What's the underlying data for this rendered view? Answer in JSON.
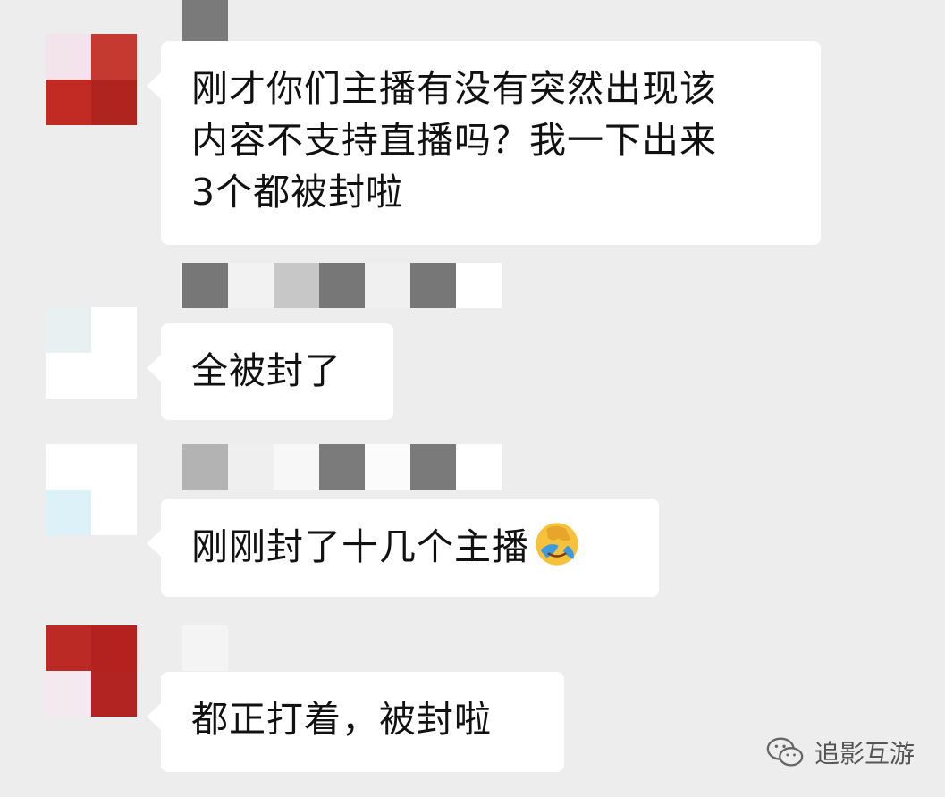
{
  "messages": [
    {
      "lines": [
        "刚才你们主播有没有突然出现该",
        "内容不支持直播吗？我一下出来",
        "3个都被封啦"
      ],
      "avatar_colors": [
        "#b42520",
        "#c53a30",
        "#c22a24",
        "#b0241f"
      ],
      "avatar_overlay": "#f2e4ea",
      "name_blocks": [
        "#7a7a7a"
      ]
    },
    {
      "lines": [
        "全被封了"
      ],
      "avatar_colors": [
        "#e8f0f2",
        "#ffffff",
        "#ffffff",
        "#ffffff"
      ],
      "name_blocks": [
        "#777777",
        "#f2f2f2",
        "#c7c7c7",
        "#777777",
        "#f0f0f0",
        "#777777",
        "#ffffff"
      ]
    },
    {
      "lines": [
        "刚刚封了十几个主播"
      ],
      "emoji": "face-palm-crying-emoji",
      "avatar_colors": [
        "#ffffff",
        "#ffffff",
        "#ddf1f8",
        "#ffffff"
      ],
      "name_blocks": [
        "#b3b3b3",
        "#efefef",
        "#f7f7f7",
        "#7b7b7b",
        "#fbfbfb",
        "#7a7a7a",
        "#ffffff"
      ]
    },
    {
      "lines": [
        "都正打着，被封啦"
      ],
      "avatar_colors": [
        "#bb2a24",
        "#b3221e",
        "#f3e9ef",
        "#b22421"
      ],
      "name_blocks": [
        "#f4f4f4"
      ]
    }
  ],
  "watermark": {
    "icon": "wechat-icon",
    "text": "追影互游"
  },
  "colors": {
    "background": "#ededed",
    "bubble": "#ffffff",
    "text": "#111111"
  }
}
